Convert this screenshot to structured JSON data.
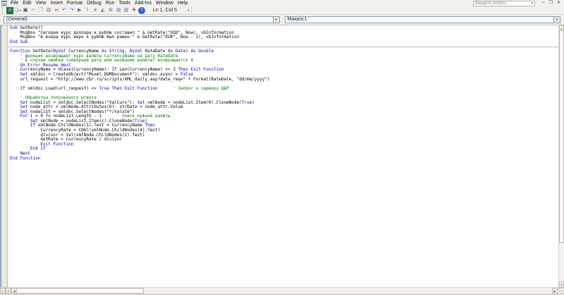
{
  "app": {
    "name": "Microsoft Visual Basic Editor"
  },
  "colors": {
    "keyword": "#0000cc",
    "comment": "#007a00",
    "text": "#000000",
    "chrome": "#f2f1ec",
    "code_bg": "#ffffff",
    "combo_border": "#7f9db9"
  },
  "menu": {
    "items": [
      "File",
      "Edit",
      "View",
      "Insert",
      "Format",
      "Debug",
      "Run",
      "Tools",
      "Add-Ins",
      "Window",
      "Help"
    ]
  },
  "question_box": {
    "placeholder": "Введите вопрос"
  },
  "window_buttons": {
    "minimize": "─",
    "restore": "❐",
    "close": "✕"
  },
  "toolbar": {
    "position_label": "Ln 1, Col 5",
    "icons": [
      {
        "name": "view-excel",
        "glyph": "X",
        "color": "#ffffff",
        "bg": "#1e7145"
      },
      {
        "name": "insert-userform",
        "glyph": "❏",
        "color": "#4a6fb5",
        "caret": true
      },
      {
        "name": "save",
        "glyph": "▣",
        "color": "#2b4a77"
      },
      {
        "name": "cut",
        "glyph": "✂",
        "color": "#aaa8a0",
        "disabled": true
      },
      {
        "name": "copy",
        "glyph": "❐",
        "color": "#aaa8a0",
        "disabled": true
      },
      {
        "name": "paste",
        "glyph": "▤",
        "color": "#8a6d3b"
      },
      {
        "name": "find",
        "glyph": "∞",
        "color": "#444444"
      },
      {
        "name": "undo",
        "glyph": "↶",
        "color": "#3a62b0"
      },
      {
        "name": "redo",
        "glyph": "↷",
        "color": "#3a62b0"
      },
      {
        "name": "run",
        "glyph": "▶",
        "color": "#4f76c9"
      },
      {
        "name": "break",
        "glyph": "‖",
        "color": "#aaa8a0",
        "disabled": true
      },
      {
        "name": "reset",
        "glyph": "■",
        "color": "#aaa8a0",
        "disabled": true
      },
      {
        "name": "design-mode",
        "glyph": "◭",
        "color": "#2d8a8a"
      },
      {
        "name": "project-explorer",
        "glyph": "⊞",
        "color": "#4a6fb5"
      },
      {
        "name": "properties-window",
        "glyph": "▤",
        "color": "#4a6fb5"
      },
      {
        "name": "object-browser",
        "glyph": "▥",
        "color": "#4a6fb5"
      },
      {
        "name": "toolbox",
        "glyph": "✚",
        "color": "#777777"
      },
      {
        "name": "help",
        "glyph": "?",
        "color": "#ffffff",
        "bg": "#2b5fd9",
        "round": true
      }
    ]
  },
  "combos": {
    "object": "(General)",
    "procedure": "Макрос1"
  },
  "scrollbars": {
    "up": "▲",
    "down": "▼",
    "left": "◀",
    "right": "▶",
    "procedure_view": "▭",
    "module_view": "≡"
  },
  "code": {
    "lines": [
      {
        "seg": [
          [
            "k",
            "Sub "
          ],
          [
            "t",
            "GetRate()"
          ]
        ]
      },
      {
        "seg": [
          [
            "t",
            "    MsgBox \"Сегодня курс доллара к рублю составил \" & GetRate(\"USD\", Now), vbInformation"
          ]
        ]
      },
      {
        "seg": [
          [
            "t",
            "    MsgBox \"А вчера курс евро к рублю был равен \" & GetRate(\"EUR\", Now - 1), vbInformation"
          ]
        ]
      },
      {
        "seg": [
          [
            "k",
            "End Sub"
          ]
        ]
      },
      {
        "sep": true
      },
      {
        "seg": [
          [
            "k",
            "Function "
          ],
          [
            "t",
            "GetRate("
          ],
          [
            "k",
            "ByVal "
          ],
          [
            "t",
            "CurrencyName "
          ],
          [
            "k",
            "As String"
          ],
          [
            "t",
            ", "
          ],
          [
            "k",
            "ByVal "
          ],
          [
            "t",
            "RateDate "
          ],
          [
            "k",
            "As Date"
          ],
          [
            "t",
            ") "
          ],
          [
            "k",
            "As Double"
          ]
        ]
      },
      {
        "seg": [
          [
            "c",
            "    ' функция возвращает курс валюты CurrencyName на дату RateDate"
          ]
        ]
      },
      {
        "seg": [
          [
            "c",
            "    ' в случае ошибки (неверная дата или название валюты) возвращается 0"
          ]
        ]
      },
      {
        "seg": [
          [
            "t",
            "    "
          ],
          [
            "k",
            "On Error Resume Next"
          ]
        ]
      },
      {
        "seg": [
          [
            "t",
            "    CurrencyName = UCase(CurrencyName): "
          ],
          [
            "k",
            "If "
          ],
          [
            "t",
            "Len(CurrencyName) <> 3 "
          ],
          [
            "k",
            "Then Exit Function"
          ]
        ]
      },
      {
        "seg": [
          [
            "t",
            "    "
          ],
          [
            "k",
            "Set "
          ],
          [
            "t",
            "xmldoc = CreateObject(\"Msxml.DOMDocument\"): xmldoc.async = "
          ],
          [
            "k",
            "False"
          ]
        ]
      },
      {
        "seg": [
          [
            "t",
            "    url_request = \"http://www.cbr.ru/scripts/XML_daily.asp?date_req=\" + Format(RateDate, \"dd/mm/yyyy\")"
          ]
        ]
      },
      {
        "seg": []
      },
      {
        "seg": [
          [
            "t",
            "    "
          ],
          [
            "k",
            "If "
          ],
          [
            "t",
            "xmldoc.Load(url_request) <> "
          ],
          [
            "k",
            "True Then Exit Function"
          ],
          [
            "c",
            "      ' Запрос к серверу ЦБР"
          ]
        ]
      },
      {
        "seg": []
      },
      {
        "seg": [
          [
            "c",
            "    ' Обработка полученного ответа"
          ]
        ]
      },
      {
        "seg": [
          [
            "t",
            "    "
          ],
          [
            "k",
            "Set "
          ],
          [
            "t",
            "nodeList = xmldoc.SelectNodes(\"ValCurs\"): "
          ],
          [
            "k",
            "Set "
          ],
          [
            "t",
            "xmlNode = nodeList.Item(0).CloneNode("
          ],
          [
            "k",
            "True"
          ],
          [
            "t",
            ")"
          ]
        ]
      },
      {
        "seg": [
          [
            "t",
            "    "
          ],
          [
            "k",
            "Set "
          ],
          [
            "t",
            "node_attr = xmlNode.Attributes(0): strDate = node_attr.Value"
          ]
        ]
      },
      {
        "seg": [
          [
            "t",
            "    "
          ],
          [
            "k",
            "Set "
          ],
          [
            "t",
            "nodeList = xmldoc.SelectNodes(\"*/Valute\")"
          ]
        ]
      },
      {
        "seg": [
          [
            "t",
            "    "
          ],
          [
            "k",
            "For "
          ],
          [
            "t",
            "i = 0 "
          ],
          [
            "k",
            "To "
          ],
          [
            "t",
            "nodeList.Length - 1"
          ],
          [
            "c",
            "      ' поиск нужной валюты"
          ]
        ]
      },
      {
        "seg": [
          [
            "t",
            "        "
          ],
          [
            "k",
            "Set "
          ],
          [
            "t",
            "xmlNode = nodeList.Item(i).CloneNode("
          ],
          [
            "k",
            "True"
          ],
          [
            "t",
            ")"
          ]
        ]
      },
      {
        "seg": [
          [
            "t",
            "        "
          ],
          [
            "k",
            "If "
          ],
          [
            "t",
            "xmlNode.ChildNodes(1).Text = CurrencyName "
          ],
          [
            "k",
            "Then"
          ]
        ]
      },
      {
        "seg": [
          [
            "t",
            "            CurrencyRate = CDbl(xmlNode.ChildNodes(4).Text)"
          ]
        ]
      },
      {
        "seg": [
          [
            "t",
            "            divisor = Val(xmlNode.ChildNodes(2).Text)"
          ]
        ]
      },
      {
        "seg": [
          [
            "t",
            "            GetRate = CurrencyRate / divisor"
          ]
        ]
      },
      {
        "seg": [
          [
            "t",
            "            "
          ],
          [
            "k",
            "Exit Function"
          ]
        ]
      },
      {
        "seg": [
          [
            "t",
            "        "
          ],
          [
            "k",
            "End If"
          ]
        ]
      },
      {
        "seg": [
          [
            "t",
            "    "
          ],
          [
            "k",
            "Next"
          ]
        ]
      },
      {
        "seg": [
          [
            "k",
            "End Function"
          ]
        ]
      }
    ]
  }
}
